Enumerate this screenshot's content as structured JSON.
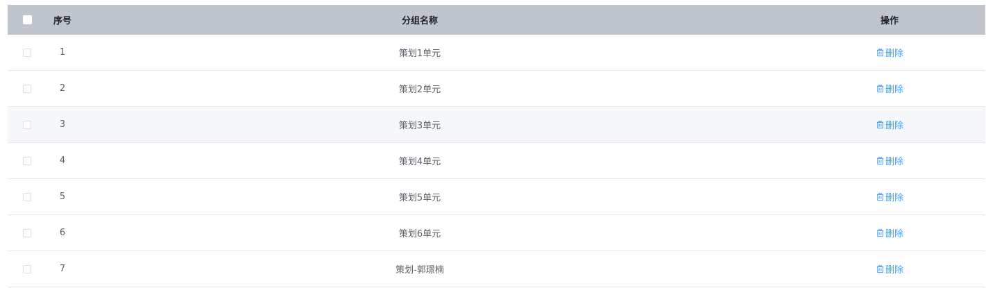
{
  "table": {
    "headers": {
      "index": "序号",
      "group_name": "分组名称",
      "actions": "操作"
    },
    "delete_label": "删除",
    "delete_icon": "trash-icon",
    "accent_color": "#409eff",
    "header_bg": "#c0c4cc",
    "rows": [
      {
        "index": "1",
        "name": "策划1单元"
      },
      {
        "index": "2",
        "name": "策划2单元"
      },
      {
        "index": "3",
        "name": "策划3单元"
      },
      {
        "index": "4",
        "name": "策划4单元"
      },
      {
        "index": "5",
        "name": "策划5单元"
      },
      {
        "index": "6",
        "name": "策划6单元"
      },
      {
        "index": "7",
        "name": "策划-郭璟楠"
      }
    ]
  }
}
